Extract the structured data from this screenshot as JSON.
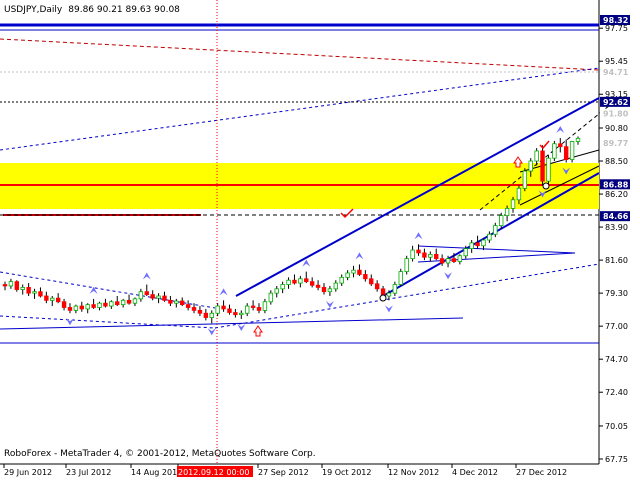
{
  "header": {
    "symbol": "USDJPY,Daily",
    "ohlc": "89.86 90.21 89.63 90.08"
  },
  "footer": {
    "copyright": "RoboForex - MetaTrader 4, © 2001-2012, MetaQuotes Software Corp."
  },
  "colors": {
    "background": "#ffffff",
    "grid": "#c0c0c0",
    "bull_candle": "#00b000",
    "bear_candle": "#ff0000",
    "channel_line": "#0000cc",
    "support_line": "#ff0000",
    "zone": "#ffff00",
    "fractal_arrow": "#6f6fff"
  },
  "icons": {
    "fractal_up": "blue-triangle-up-icon",
    "fractal_down": "blue-triangle-down-icon",
    "buy_arrow": "red-outline-up-arrow-icon",
    "check": "red-check-icon",
    "circle": "white-circle-icon"
  },
  "chart_data": {
    "type": "candlestick",
    "title": "USDJPY,Daily",
    "ohlc_last": {
      "open": 89.86,
      "high": 90.21,
      "low": 89.63,
      "close": 90.08
    },
    "y_axis": {
      "side": "right",
      "range": [
        67.75,
        98.32
      ],
      "ticks": [
        "97.75",
        "95.45",
        "93.15",
        "90.80",
        "88.50",
        "86.20",
        "83.90",
        "81.60",
        "79.30",
        "77.00",
        "74.70",
        "72.40",
        "70.05",
        "67.75"
      ],
      "level_labels": [
        {
          "text": "98.32",
          "value": 98.32,
          "fill": "#000080",
          "color": "#ffffff"
        },
        {
          "text": "94.71",
          "value": 94.71,
          "fill": "#ffffff",
          "color": "#c0c0c0"
        },
        {
          "text": "92.62",
          "value": 92.62,
          "fill": "#000080",
          "color": "#ffffff"
        },
        {
          "text": "91.80",
          "value": 91.8,
          "fill": "#ffffff",
          "color": "#c0c0c0"
        },
        {
          "text": "89.77",
          "value": 89.77,
          "fill": "#ffffff",
          "color": "#c0c0c0"
        },
        {
          "text": "86.88",
          "value": 86.88,
          "fill": "#000080",
          "color": "#ffffff"
        },
        {
          "text": "84.66",
          "value": 84.66,
          "fill": "#000080",
          "color": "#ffffff"
        }
      ]
    },
    "x_axis": {
      "labels": [
        "29 Jun 2012",
        "23 Jul 2012",
        "14 Aug 2012",
        "2012.09.12 00:00",
        "27 Sep 2012",
        "19 Oct 2012",
        "12 Nov 2012",
        "4 Dec 2012",
        "27 Dec 2012"
      ],
      "highlighted": "2012.09.12 00:00"
    },
    "zone": {
      "from": 85.1,
      "to": 88.9
    },
    "horizontal_levels": [
      98.32,
      92.62,
      86.88,
      84.66,
      76.3
    ],
    "vertical_marker": "2012.09.12 00:00",
    "candles": [
      [
        79.9,
        80.1,
        79.5,
        79.8
      ],
      [
        79.8,
        80.3,
        79.6,
        80.1
      ],
      [
        80.1,
        80.2,
        79.4,
        79.55
      ],
      [
        79.55,
        79.9,
        79.2,
        79.7
      ],
      [
        79.7,
        80.0,
        79.1,
        79.3
      ],
      [
        79.3,
        79.6,
        78.9,
        79.4
      ],
      [
        79.4,
        79.7,
        79.0,
        79.1
      ],
      [
        79.1,
        79.4,
        78.6,
        78.8
      ],
      [
        78.8,
        79.1,
        78.4,
        78.95
      ],
      [
        78.95,
        79.3,
        78.6,
        78.7
      ],
      [
        78.7,
        78.9,
        78.1,
        78.3
      ],
      [
        78.3,
        78.6,
        77.9,
        78.1
      ],
      [
        78.1,
        78.5,
        77.9,
        78.4
      ],
      [
        78.4,
        78.7,
        78.0,
        78.2
      ],
      [
        78.2,
        78.6,
        77.9,
        78.5
      ],
      [
        78.5,
        78.9,
        78.2,
        78.3
      ],
      [
        78.3,
        78.7,
        78.1,
        78.6
      ],
      [
        78.6,
        78.9,
        78.3,
        78.4
      ],
      [
        78.4,
        78.8,
        78.2,
        78.7
      ],
      [
        78.7,
        79.1,
        78.4,
        78.5
      ],
      [
        78.5,
        78.9,
        78.3,
        78.8
      ],
      [
        78.8,
        79.2,
        78.5,
        78.6
      ],
      [
        78.6,
        79.0,
        78.4,
        78.9
      ],
      [
        78.9,
        79.6,
        78.7,
        79.4
      ],
      [
        79.4,
        79.9,
        79.1,
        79.2
      ],
      [
        79.2,
        79.5,
        78.8,
        78.95
      ],
      [
        78.95,
        79.3,
        78.6,
        79.1
      ],
      [
        79.1,
        79.4,
        78.7,
        78.8
      ],
      [
        78.8,
        79.1,
        78.4,
        78.6
      ],
      [
        78.6,
        78.9,
        78.3,
        78.75
      ],
      [
        78.75,
        79.0,
        78.4,
        78.5
      ],
      [
        78.5,
        78.8,
        78.1,
        78.3
      ],
      [
        78.3,
        78.6,
        77.9,
        78.1
      ],
      [
        78.1,
        78.4,
        77.7,
        77.9
      ],
      [
        77.9,
        78.2,
        77.4,
        77.6
      ],
      [
        77.6,
        78.1,
        77.2,
        77.9
      ],
      [
        77.9,
        78.6,
        77.7,
        78.4
      ],
      [
        78.4,
        78.8,
        78.0,
        78.2
      ],
      [
        78.2,
        78.5,
        77.8,
        77.95
      ],
      [
        77.95,
        78.2,
        77.6,
        77.8
      ],
      [
        77.8,
        78.1,
        77.5,
        77.9
      ],
      [
        77.9,
        78.6,
        77.7,
        78.4
      ],
      [
        78.4,
        78.8,
        78.1,
        78.3
      ],
      [
        78.3,
        78.6,
        77.9,
        78.1
      ],
      [
        78.1,
        78.9,
        77.9,
        78.7
      ],
      [
        78.7,
        79.5,
        78.5,
        79.3
      ],
      [
        79.3,
        79.8,
        79.0,
        79.6
      ],
      [
        79.6,
        80.1,
        79.3,
        79.9
      ],
      [
        79.9,
        80.4,
        79.6,
        80.2
      ],
      [
        80.2,
        80.6,
        79.9,
        80.0
      ],
      [
        80.0,
        80.5,
        79.7,
        80.3
      ],
      [
        80.3,
        80.8,
        80.0,
        80.1
      ],
      [
        80.1,
        80.4,
        79.7,
        79.85
      ],
      [
        79.85,
        80.2,
        79.5,
        79.7
      ],
      [
        79.7,
        80.0,
        79.2,
        79.4
      ],
      [
        79.4,
        79.8,
        79.1,
        79.6
      ],
      [
        79.6,
        80.2,
        79.4,
        80.0
      ],
      [
        80.0,
        80.6,
        79.8,
        80.4
      ],
      [
        80.4,
        80.9,
        80.2,
        80.7
      ],
      [
        80.7,
        81.2,
        80.4,
        80.9
      ],
      [
        80.9,
        81.3,
        80.5,
        80.6
      ],
      [
        80.6,
        80.9,
        80.1,
        80.3
      ],
      [
        80.3,
        80.6,
        79.8,
        79.95
      ],
      [
        79.95,
        80.2,
        79.4,
        79.6
      ],
      [
        79.6,
        79.8,
        78.9,
        79.1
      ],
      [
        79.1,
        79.5,
        78.8,
        79.3
      ],
      [
        79.3,
        80.1,
        79.1,
        79.9
      ],
      [
        79.9,
        81.0,
        79.8,
        80.8
      ],
      [
        80.8,
        81.9,
        80.6,
        81.7
      ],
      [
        81.7,
        82.6,
        81.5,
        82.3
      ],
      [
        82.3,
        82.7,
        81.9,
        82.1
      ],
      [
        82.1,
        82.4,
        81.6,
        81.8
      ],
      [
        81.8,
        82.2,
        81.5,
        82.0
      ],
      [
        82.0,
        82.4,
        81.6,
        81.7
      ],
      [
        81.7,
        82.0,
        81.2,
        81.4
      ],
      [
        81.4,
        81.9,
        81.1,
        81.7
      ],
      [
        81.7,
        82.1,
        81.4,
        81.5
      ],
      [
        81.5,
        82.0,
        81.3,
        81.9
      ],
      [
        81.9,
        82.6,
        81.7,
        82.4
      ],
      [
        82.4,
        83.0,
        82.1,
        82.8
      ],
      [
        82.8,
        83.3,
        82.4,
        82.6
      ],
      [
        82.6,
        83.1,
        82.3,
        83.0
      ],
      [
        83.0,
        83.6,
        82.8,
        83.4
      ],
      [
        83.4,
        84.2,
        83.2,
        84.0
      ],
      [
        84.0,
        84.9,
        83.8,
        84.7
      ],
      [
        84.7,
        85.4,
        84.3,
        85.2
      ],
      [
        85.2,
        86.0,
        84.9,
        85.8
      ],
      [
        85.8,
        86.8,
        85.5,
        86.6
      ],
      [
        86.6,
        88.0,
        86.4,
        87.8
      ],
      [
        87.8,
        88.7,
        87.4,
        88.5
      ],
      [
        88.5,
        89.4,
        88.2,
        89.2
      ],
      [
        89.2,
        89.6,
        86.8,
        87.1
      ],
      [
        87.1,
        88.9,
        86.9,
        88.7
      ],
      [
        88.7,
        89.9,
        88.5,
        89.7
      ],
      [
        89.7,
        90.1,
        89.1,
        89.5
      ],
      [
        89.5,
        90.0,
        88.4,
        88.6
      ],
      [
        88.6,
        89.9,
        88.4,
        89.86
      ],
      [
        89.86,
        90.21,
        89.63,
        90.08
      ]
    ]
  }
}
